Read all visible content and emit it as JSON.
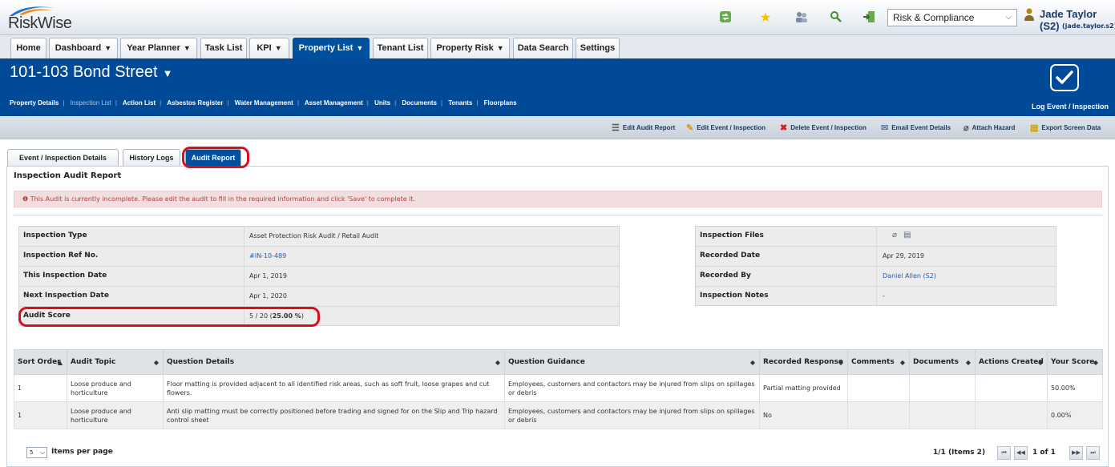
{
  "app": {
    "logo_text": "RiskWise",
    "role_select": {
      "value": "Risk & Compliance"
    },
    "user": {
      "name": "Jade Taylor (S2)",
      "login": "(jade.taylor.s2)"
    }
  },
  "nav": {
    "tabs": [
      {
        "label": "Home",
        "dropdown": false
      },
      {
        "label": "Dashboard",
        "dropdown": true
      },
      {
        "label": "Year Planner",
        "dropdown": true
      },
      {
        "label": "Task List",
        "dropdown": false
      },
      {
        "label": "KPI",
        "dropdown": true
      },
      {
        "label": "Property List",
        "dropdown": true,
        "active": true
      },
      {
        "label": "Tenant List",
        "dropdown": false
      },
      {
        "label": "Property Risk",
        "dropdown": true
      },
      {
        "label": "Data Search",
        "dropdown": false
      },
      {
        "label": "Settings",
        "dropdown": false
      }
    ]
  },
  "property": {
    "title": "101-103 Bond Street",
    "subnav": [
      "Property Details",
      "Inspection List",
      "Action List",
      "Asbestos Register",
      "Water Management",
      "Asset Management",
      "Units",
      "Documents",
      "Tenants",
      "Floorplans"
    ],
    "log_event_label": "Log Event / Inspection"
  },
  "toolbar": {
    "edit_audit_report": "Edit Audit Report",
    "edit_event": "Edit Event / Inspection",
    "delete_event": "Delete Event / Inspection",
    "email_event": "Email Event Details",
    "attach_hazard": "Attach Hazard",
    "export_screen": "Export Screen Data"
  },
  "content_tabs": [
    "Event / Inspection Details",
    "History Logs",
    "Audit Report"
  ],
  "report": {
    "title": "Inspection Audit Report",
    "alert": "This Audit is currently incomplete. Please edit the audit to fill in the required information and click 'Save' to complete it.",
    "left_info": {
      "inspection_type_label": "Inspection Type",
      "inspection_type": "Asset Protection Risk Audit / Retail Audit",
      "ref_label": "Inspection Ref No.",
      "ref": "#IN-10-489",
      "this_date_label": "This Inspection Date",
      "this_date": "Apr 1, 2019",
      "next_date_label": "Next Inspection Date",
      "next_date": "Apr 1, 2020",
      "score_label": "Audit Score",
      "score_prefix": "5 / 20 (",
      "score_pct": "25.00 %",
      "score_suffix": ")"
    },
    "right_info": {
      "files_label": "Inspection Files",
      "recorded_date_label": "Recorded Date",
      "recorded_date": "Apr 29, 2019",
      "recorded_by_label": "Recorded By",
      "recorded_by": "Daniel Allen (S2)",
      "notes_label": "Inspection Notes",
      "notes": "-"
    }
  },
  "grid": {
    "columns": [
      "Sort Order",
      "Audit Topic",
      "Question Details",
      "Question Guidance",
      "Recorded Response",
      "Comments",
      "Documents",
      "Actions Created",
      "Your Score"
    ],
    "rows": [
      {
        "sort": "1",
        "topic": "Loose produce and horticulture",
        "details": "Floor matting is provided adjacent to all identified risk areas, such as soft fruit, loose grapes and cut flowers.",
        "guidance": "Employees, customers and contactors may be injured from slips on spillages or debris",
        "response": "Partial matting provided",
        "comments": "",
        "documents": "",
        "actions": "",
        "score": "50.00%"
      },
      {
        "sort": "1",
        "topic": "Loose produce and horticulture",
        "details": "Anti slip matting must be correctly positioned before trading and signed for on the Slip and Trip hazard control sheet",
        "guidance": "Employees, customers and contactors may be injured from slips on spillages or debris",
        "response": "No",
        "comments": "",
        "documents": "",
        "actions": "",
        "score": "0.00%"
      }
    ]
  },
  "pager": {
    "per_page": "5",
    "per_page_label": "Items per page",
    "summary": "1/1 (Items 2)",
    "page_label": "1 of 1"
  }
}
